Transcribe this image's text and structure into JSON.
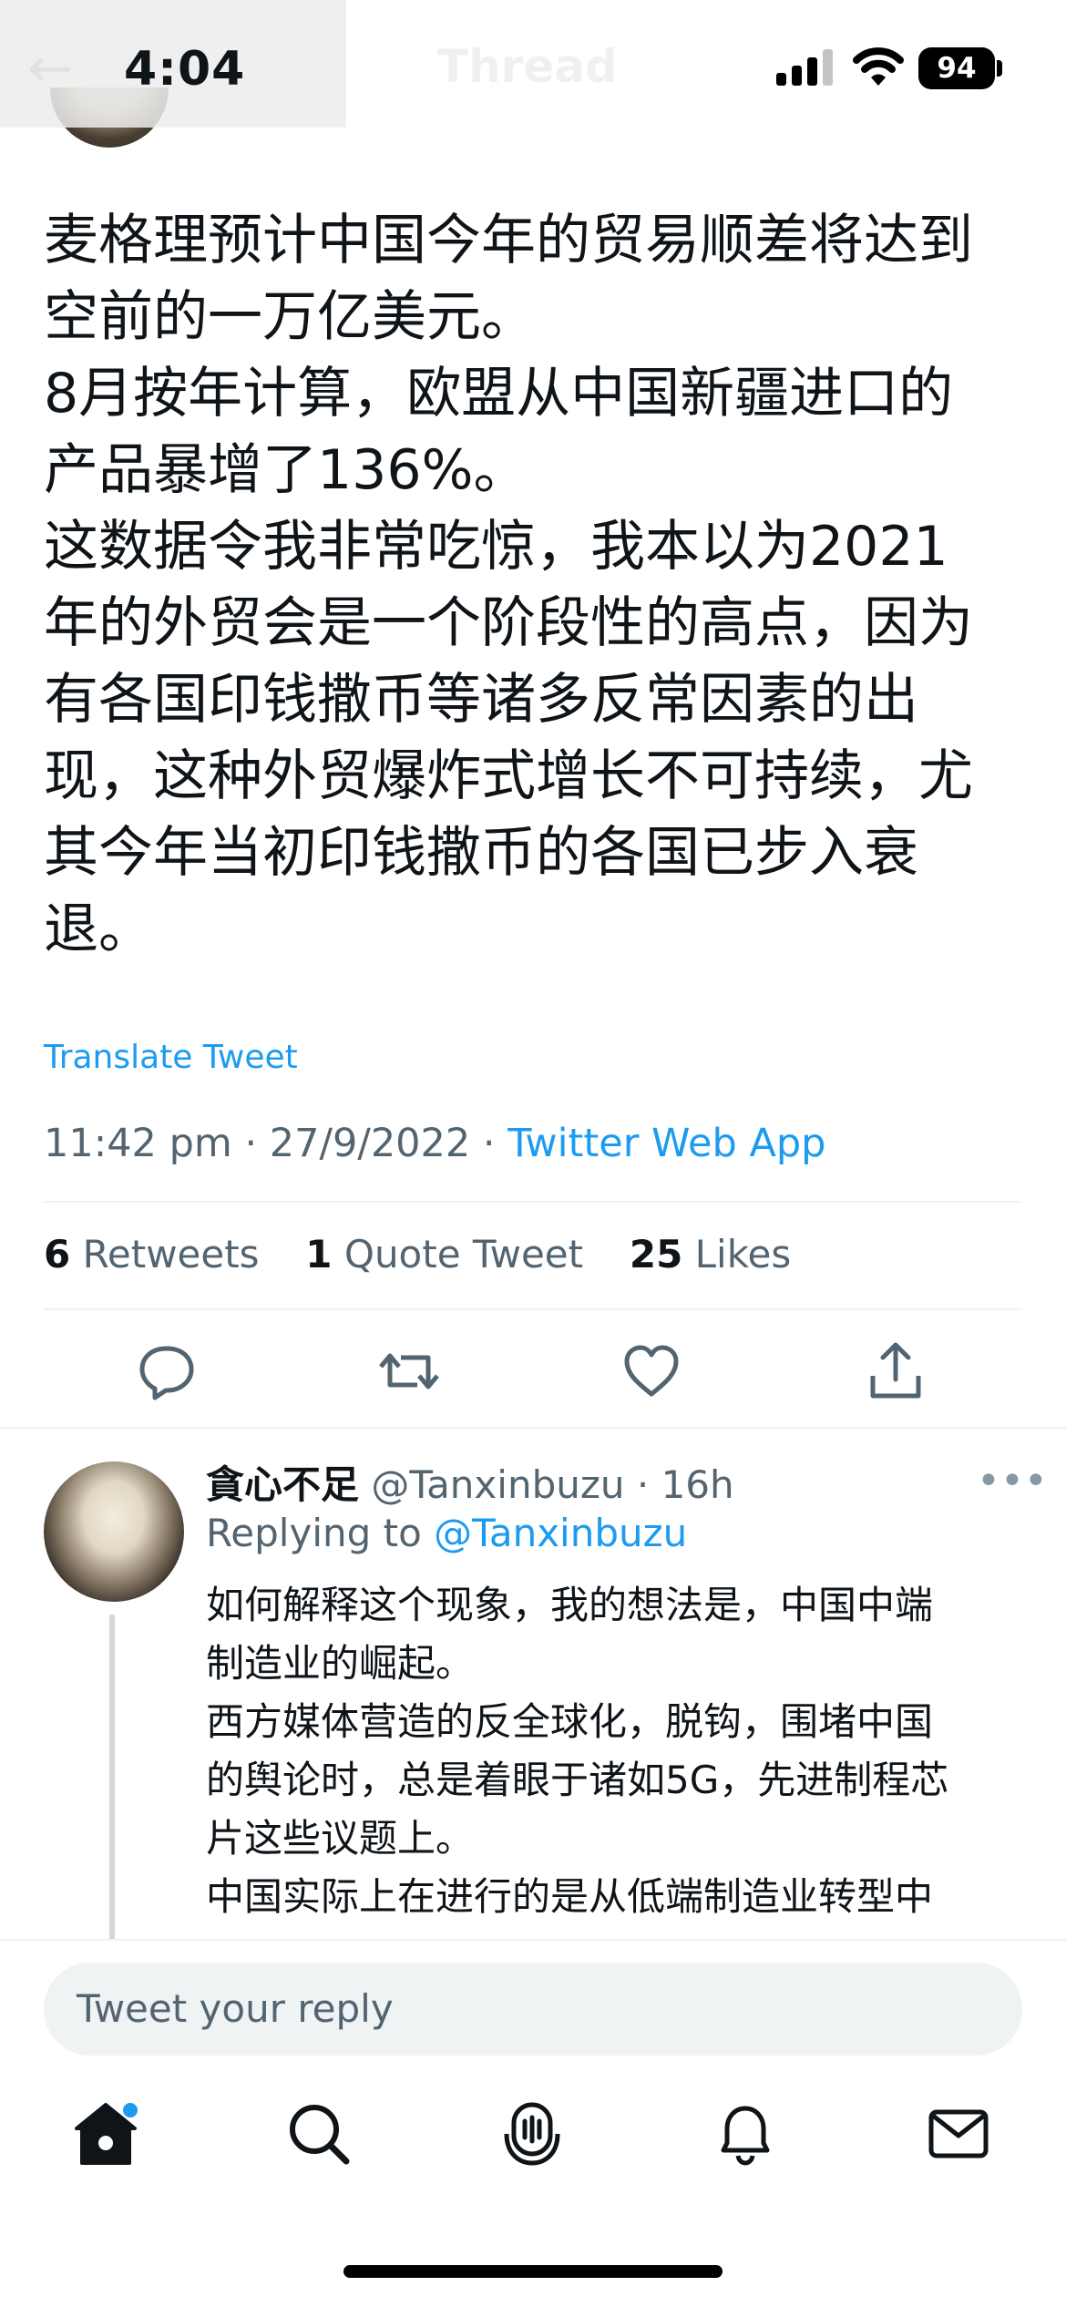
{
  "status_bar": {
    "time": "4:04",
    "battery": "94"
  },
  "nav": {
    "title": "Thread"
  },
  "tweet": {
    "text": "麦格理预计中国今年的贸易顺差将达到\n空前的一万亿美元。\n8月按年计算，欧盟从中国新疆进口的\n产品暴增了136%。\n这数据令我非常吃惊，我本以为2021\n年的外贸会是一个阶段性的高点，因为\n有各国印钱撒币等诸多反常因素的出\n现，这种外贸爆炸式增长不可持续，尤\n其今年当初印钱撒币的各国已步入衰\n退。",
    "translate_label": "Translate Tweet",
    "timestamp": "11:42 pm · 27/9/2022 · ",
    "source_app": "Twitter Web App",
    "retweets_count": "6",
    "retweets_label": " Retweets",
    "quotes_count": "1",
    "quotes_label": " Quote Tweet",
    "likes_count": "25",
    "likes_label": " Likes"
  },
  "reply": {
    "name": "貪心不足",
    "handle": " @Tanxinbuzu · 16h",
    "replying_prefix": "Replying to ",
    "replying_handle": "@Tanxinbuzu",
    "text": "如何解释这个现象，我的想法是，中国中端\n制造业的崛起。\n西方媒体营造的反全球化，脱钩，围堵中国\n的舆论时，总是着眼于诸如5G，先进制程芯\n片这些议题上。\n中国实际上在进行的是从低端制造业转型中\n端制造业的过程，劳动密集（低人权）的低"
  },
  "composer": {
    "placeholder": "Tweet your reply"
  },
  "colors": {
    "accent": "#1d9bf0",
    "secondary_text": "#536471",
    "divider": "#eff3f4"
  },
  "tabs": [
    "home-icon",
    "search-icon",
    "spaces-icon",
    "notifications-icon",
    "messages-icon"
  ]
}
